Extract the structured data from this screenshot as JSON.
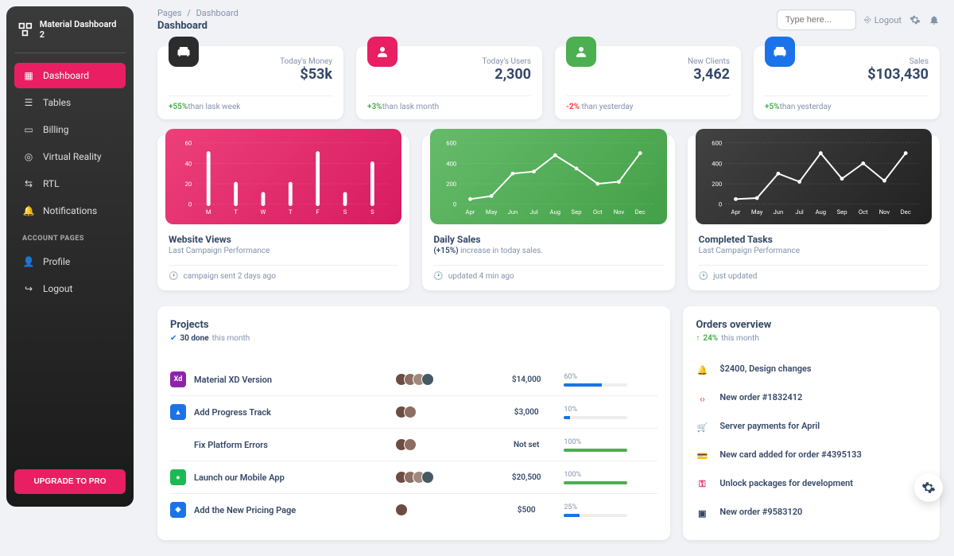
{
  "brand": "Material Dashboard 2",
  "nav_heading": "ACCOUNT PAGES",
  "nav": [
    {
      "label": "Dashboard",
      "active": true
    },
    {
      "label": "Tables"
    },
    {
      "label": "Billing"
    },
    {
      "label": "Virtual Reality"
    },
    {
      "label": "RTL"
    },
    {
      "label": "Notifications"
    }
  ],
  "account_nav": [
    {
      "label": "Profile"
    },
    {
      "label": "Logout"
    }
  ],
  "upgrade": "UPGRADE TO PRO",
  "breadcrumb": {
    "root": "Pages",
    "current": "Dashboard"
  },
  "page_title": "Dashboard",
  "search_placeholder": "Type here...",
  "logout": "Logout",
  "stats": [
    {
      "label": "Today's Money",
      "value": "$53k",
      "pct": "+55%",
      "trend": "up",
      "suffix": "than lask week"
    },
    {
      "label": "Today's Users",
      "value": "2,300",
      "pct": "+3%",
      "trend": "up",
      "suffix": "than lask month"
    },
    {
      "label": "New Clients",
      "value": "3,462",
      "pct": "-2%",
      "trend": "down",
      "suffix": " than yesterday"
    },
    {
      "label": "Sales",
      "value": "$103,430",
      "pct": "+5%",
      "trend": "up",
      "suffix": "than yesterday"
    }
  ],
  "charts": [
    {
      "title": "Website Views",
      "sub": "Last Campaign Performance",
      "foot": "campaign sent 2 days ago"
    },
    {
      "title": "Daily Sales",
      "sub_prefix": "(+15%)",
      "sub": " increase in today sales.",
      "foot": "updated 4 min ago"
    },
    {
      "title": "Completed Tasks",
      "sub": "Last Campaign Performance",
      "foot": "just updated"
    }
  ],
  "projects": {
    "title": "Projects",
    "done": "30 done",
    "done_suffix": " this month",
    "rows": [
      {
        "name": "Material XD Version",
        "ico_bg": "#8e24aa",
        "ico_txt": "Xd",
        "members": 4,
        "budget": "$14,000",
        "pct": "60%",
        "pct_n": 60,
        "bar": "#1a73e8"
      },
      {
        "name": "Add Progress Track",
        "ico_bg": "#1a73e8",
        "ico_txt": "▲",
        "members": 2,
        "budget": "$3,000",
        "pct": "10%",
        "pct_n": 10,
        "bar": "#1a73e8"
      },
      {
        "name": "Fix Platform Errors",
        "ico_bg": "#fff",
        "ico_txt": "✱",
        "members": 2,
        "budget": "Not set",
        "pct": "100%",
        "pct_n": 100,
        "bar": "#4caf50"
      },
      {
        "name": "Launch our Mobile App",
        "ico_bg": "#1db954",
        "ico_txt": "●",
        "members": 4,
        "budget": "$20,500",
        "pct": "100%",
        "pct_n": 100,
        "bar": "#4caf50"
      },
      {
        "name": "Add the New Pricing Page",
        "ico_bg": "#1a73e8",
        "ico_txt": "◆",
        "members": 1,
        "budget": "$500",
        "pct": "25%",
        "pct_n": 25,
        "bar": "#1a73e8"
      }
    ]
  },
  "orders": {
    "title": "Orders overview",
    "pct": "24%",
    "suffix": " this month",
    "items": [
      {
        "label": "$2400, Design changes",
        "color": "#4caf50",
        "glyph": "🔔"
      },
      {
        "label": "New order #1832412",
        "color": "#f44336",
        "glyph": "‹›"
      },
      {
        "label": "Server payments for April",
        "color": "#1a73e8",
        "glyph": "🛒"
      },
      {
        "label": "New card added for order #4395133",
        "color": "#fb8c00",
        "glyph": "💳"
      },
      {
        "label": "Unlock packages for development",
        "color": "#e91e63",
        "glyph": "⚿"
      },
      {
        "label": "New order #9583120",
        "color": "#344767",
        "glyph": "▣"
      }
    ]
  },
  "chart_data": [
    {
      "type": "bar",
      "title": "Website Views",
      "categories": [
        "M",
        "T",
        "W",
        "T",
        "F",
        "S",
        "S"
      ],
      "values": [
        50,
        20,
        10,
        20,
        50,
        10,
        40
      ],
      "ylim": [
        0,
        60
      ],
      "yticks": [
        0,
        20,
        40,
        60
      ]
    },
    {
      "type": "line",
      "title": "Daily Sales",
      "categories": [
        "Apr",
        "May",
        "Jun",
        "Jul",
        "Aug",
        "Sep",
        "Oct",
        "Nov",
        "Dec"
      ],
      "values": [
        50,
        80,
        300,
        320,
        480,
        350,
        200,
        220,
        500
      ],
      "ylim": [
        0,
        600
      ],
      "yticks": [
        0,
        200,
        400,
        600
      ]
    },
    {
      "type": "line",
      "title": "Completed Tasks",
      "categories": [
        "Apr",
        "May",
        "Jun",
        "Jul",
        "Aug",
        "Sep",
        "Oct",
        "Nov",
        "Dec"
      ],
      "values": [
        50,
        60,
        300,
        220,
        500,
        250,
        400,
        230,
        500
      ],
      "ylim": [
        0,
        600
      ],
      "yticks": [
        0,
        200,
        400,
        600
      ]
    }
  ]
}
